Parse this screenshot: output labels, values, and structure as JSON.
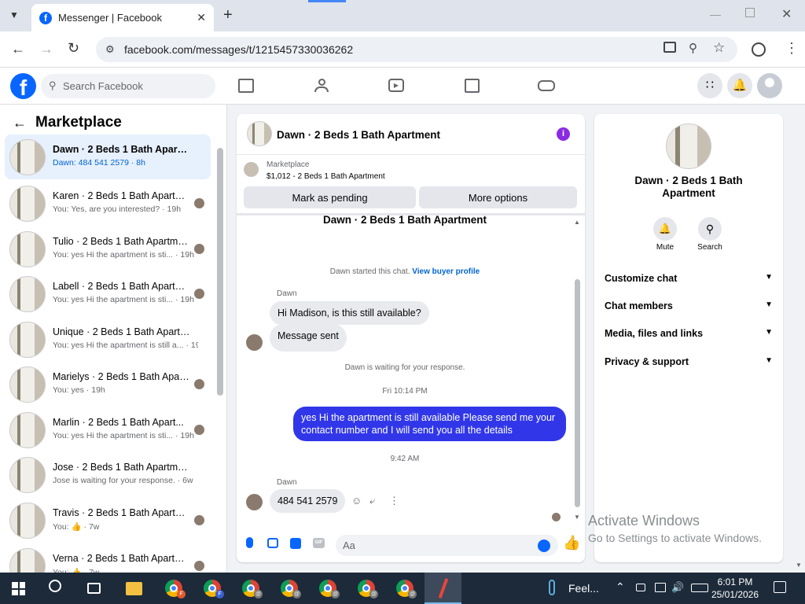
{
  "browser": {
    "tab_title": "Messenger | Facebook",
    "url": "facebook.com/messages/t/1215457330036262"
  },
  "fb": {
    "search_placeholder": "Search Facebook"
  },
  "left": {
    "title": "Marketplace",
    "conversations": [
      {
        "name": "Dawn · 2 Beds 1 Bath Apartment",
        "preview": "Dawn: 484 541 2579 · 8h",
        "active": true
      },
      {
        "name": "Karen · 2 Beds 1 Bath Apartm...",
        "preview": "You: Yes, are you interested? · 19h"
      },
      {
        "name": "Tulio · 2 Beds 1 Bath Apartment",
        "preview": "You: yes Hi the apartment is sti... · 19h"
      },
      {
        "name": "Labell · 2 Beds 1 Bath Apartm...",
        "preview": "You: yes Hi the apartment is sti... · 19h"
      },
      {
        "name": "Unique · 2 Beds 1 Bath Apartment",
        "preview": "You: yes Hi the apartment is still a... · 19h"
      },
      {
        "name": "Marielys · 2 Beds 1 Bath Apar...",
        "preview": "You: yes · 19h"
      },
      {
        "name": "Marlin · 2 Beds 1 Bath Apart...",
        "preview": "You: yes Hi the apartment is sti... · 19h"
      },
      {
        "name": "Jose · 2 Beds 1 Bath Apartment",
        "preview": "Jose is waiting for your response. · 6w"
      },
      {
        "name": "Travis · 2 Beds 1 Bath Apartm...",
        "preview": "You: 👍 · 7w"
      },
      {
        "name": "Verna · 2 Beds 1 Bath Apartm...",
        "preview": "You: 👍 · 7w"
      }
    ]
  },
  "chat": {
    "title": "Dawn · 2 Beds 1 Bath Apartment",
    "listing_source": "Marketplace",
    "listing_price": "$1,012 - 2 Beds 1 Bath Apartment",
    "mark_pending": "Mark as pending",
    "more_options": "More options",
    "thread_title": "Dawn · 2 Beds 1 Bath Apartment",
    "started_text": "Dawn started this chat.",
    "view_buyer": "View buyer profile",
    "sender_name": "Dawn",
    "msg1": "Hi Madison, is this still available?",
    "msg2": "Message sent",
    "waiting": "Dawn is waiting for your response.",
    "time1": "Fri 10:14 PM",
    "outgoing": "yes Hi the apartment is still available Please send me your contact number and I will send you all the details",
    "time2": "9:42 AM",
    "sender_name2": "Dawn",
    "msg3": "484  541  2579",
    "input_placeholder": "Aa"
  },
  "right": {
    "name": "Dawn · 2 Beds 1 Bath Apartment",
    "mute": "Mute",
    "search": "Search",
    "sections": [
      "Customize chat",
      "Chat members",
      "Media, files and links",
      "Privacy & support"
    ]
  },
  "watermark": {
    "line1": "Activate Windows",
    "line2": "Go to Settings to activate Windows."
  },
  "taskbar": {
    "weather": "Feel...",
    "time": "6:01 PM",
    "date": "25/01/2026"
  }
}
